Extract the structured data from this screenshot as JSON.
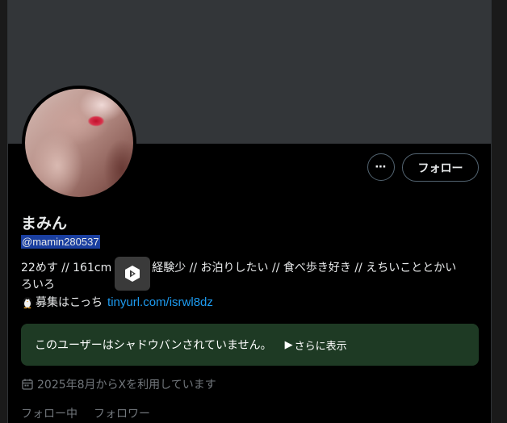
{
  "profile": {
    "display_name": "まみん",
    "handle": "@mamin280537",
    "bio_line1_a": "22めす // 161cm",
    "bio_line1_b": "経験少 // お泊りしたい // 食べ歩き好き // えちいこととかい",
    "bio_line2": "ろいろ",
    "bio_line3_text": "募集はこっち",
    "bio_link": "tinyurl.com/isrwl8dz"
  },
  "actions": {
    "more_label": "⋯",
    "follow_label": "フォロー"
  },
  "notice": {
    "text": "このユーザーはシャドウバンされていません。",
    "more_label": "さらに表示",
    "more_icon": "▶"
  },
  "meta": {
    "joined_text": "2025年8月からXを利用しています"
  },
  "stats": {
    "following_label": "フォロー中",
    "followers_label": "フォロワー"
  },
  "colors": {
    "link": "#1d9bf0",
    "notice_bg": "#1e3a24",
    "handle_highlight": "#1a3fa0"
  }
}
